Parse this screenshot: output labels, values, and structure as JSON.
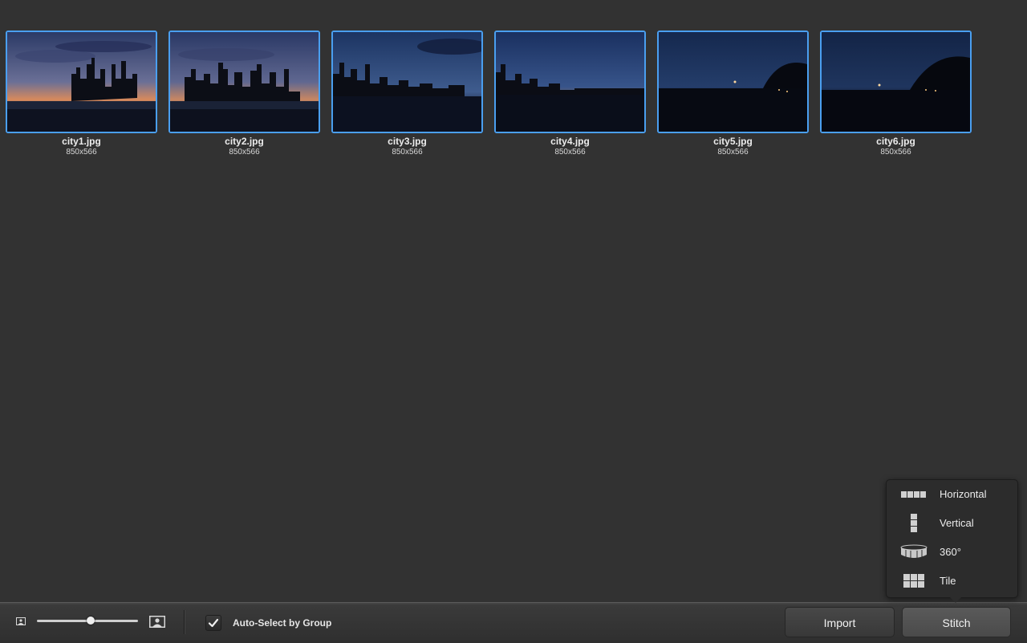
{
  "images": [
    {
      "name": "city1.jpg",
      "dims": "850x566"
    },
    {
      "name": "city2.jpg",
      "dims": "850x566"
    },
    {
      "name": "city3.jpg",
      "dims": "850x566"
    },
    {
      "name": "city4.jpg",
      "dims": "850x566"
    },
    {
      "name": "city5.jpg",
      "dims": "850x566"
    },
    {
      "name": "city6.jpg",
      "dims": "850x566"
    }
  ],
  "toolbar": {
    "thumbnail_size": 0.53,
    "auto_select_label": "Auto-Select by Group",
    "auto_select_checked": true,
    "import_label": "Import",
    "stitch_label": "Stitch"
  },
  "stitch_menu": {
    "items": [
      {
        "label": "Horizontal",
        "icon": "horizontal-layout-icon"
      },
      {
        "label": "Vertical",
        "icon": "vertical-layout-icon"
      },
      {
        "label": "360°",
        "icon": "panorama-360-icon"
      },
      {
        "label": "Tile",
        "icon": "tile-layout-icon"
      }
    ]
  },
  "colors": {
    "background": "#323232",
    "selection_border": "#4a9ff0"
  }
}
